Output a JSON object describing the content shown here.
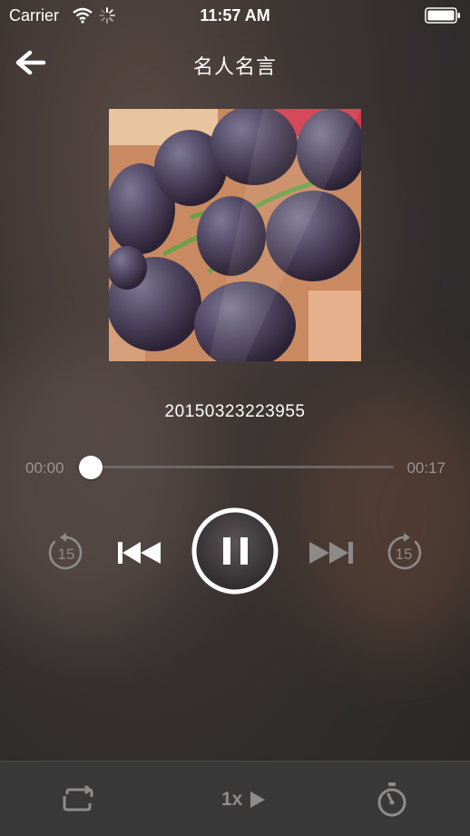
{
  "status_bar": {
    "carrier": "Carrier",
    "time": "11:57 AM"
  },
  "nav": {
    "title": "名人名言"
  },
  "track": {
    "title": "20150323223955",
    "elapsed": "00:00",
    "duration": "00:17",
    "progress": 0.0
  },
  "controls": {
    "skip_back_seconds": "15",
    "skip_forward_seconds": "15",
    "state": "playing"
  },
  "toolbar": {
    "speed_label": "1x"
  },
  "icons": [
    "back-arrow-icon",
    "wifi-icon",
    "spinner-icon",
    "battery-icon",
    "rewind-15-icon",
    "previous-track-icon",
    "pause-icon",
    "next-track-icon",
    "forward-15-icon",
    "repeat-icon",
    "play-speed-icon",
    "timer-icon"
  ],
  "colors": {
    "background": "#3a3634",
    "secondary_text": "#9a9594",
    "toolbar_bg": "#3a3939"
  }
}
